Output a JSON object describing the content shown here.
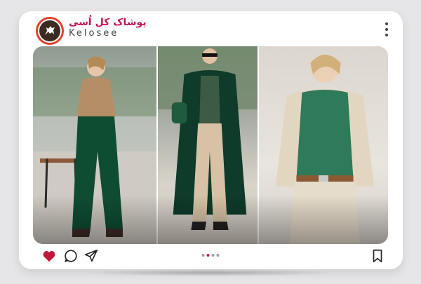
{
  "post": {
    "brand_name_fa": "پوشاک کل اُسی",
    "brand_name_en": "Kelosee",
    "avatar_icon": "horse-logo-icon",
    "more_icon": "more-vertical-icon"
  },
  "media": {
    "panels": [
      "fashion-look-1",
      "fashion-look-2",
      "fashion-look-3"
    ]
  },
  "actions": {
    "liked": true,
    "like_color": "#c2183a",
    "icons": [
      "heart-icon",
      "comment-icon",
      "share-icon",
      "bookmark-icon"
    ]
  },
  "carousel": {
    "dots": 4,
    "active_index": 1,
    "active_color": "#c2185b",
    "inactive_color": "#9aa0a6"
  },
  "colors": {
    "accent": "#c2185b",
    "card": "#ffffff",
    "background": "#e6e6e8"
  }
}
